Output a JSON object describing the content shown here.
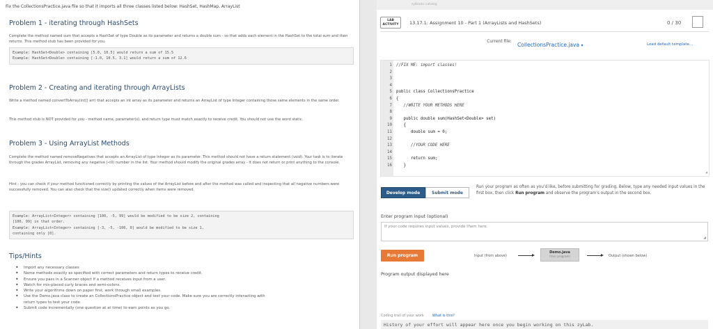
{
  "instructions": {
    "intro": "Fix the CollectionsPractice.java file so that it imports all three classes listed below: HashSet, HashMap, ArrayList",
    "p1_title": "Problem 1 - iterating through HashSets",
    "p1_text": "Complete the method named sum that accepts a HashSet of type Double as its parameter and returns a double sum - so that adds each element in the HashSet to the total sum and then returns. This method stub has been provided for you.",
    "p1_example1": "Example: HashSet<Double> containing [5.0, 10.5] would return a sum of 15.5",
    "p1_example2": "Example: HashSet<Double> containing [-1.0, 10.5, 3.1] would return a sum of 12.6",
    "p2_title": "Problem 2 - Creating and iterating through ArrayLists",
    "p2_text1": "Write a method named convertToArray(int[] arr) that accepts an int array as its parameter and returns an ArrayList of type Integer containing those same elements in the same order.",
    "p2_text2": "This method stub is NOT provided for you - method name, parameter(s), and return type must match exactly to receive credit. You should not use the word static.",
    "p3_title": "Problem 3 - Using ArrayList Methods",
    "p3_text1": "Complete the method named removeNegatives that accepts an ArrayList of type Integer as its parameter. This method should not have a return statement (void). Your task is to iterate through the grades ArrayList, removing any negative (<0) number in the list. Your method should modify the original grades array - it does not return or print anything to the console.",
    "p3_text2": "Hint - you can check if your method functioned correctly by printing the values of the ArrayList before and after the method was called and inspecting that all negative numbers were successfully removed. You can also check that the size() updated correctly when items were removed.",
    "p3_example1": "Example: ArrayList<Integer> containing [100, -5, 99] would be modified to be size 2, containing\n[100, 99] in that order.",
    "p3_example2": "Example: ArrayList<Integer> containing [-3, -5, -100, 0] would be modified to be size 1,\ncontaining only [0].",
    "tips_title": "Tips/Hints",
    "tips": [
      "Import any necessary classes",
      "Name methods exactly as specified with correct parameters and return types to receive credit.",
      "Ensure you pass in a Scanner object if a method receives input from a user.",
      "Watch for mis-placed curly braces and semi-colons.",
      "Write your algorithms down on paper first, work through small examples.",
      "Use the Demo.java class to create an CollectionsPractice object and test your code. Make sure you are correctly interacting with",
      "return types to test your code.",
      "Submit code incrementally (one question at at time) to earn points as you go."
    ]
  },
  "lab": {
    "breadcrumb": "zyBooks catalog",
    "badge_line1": "LAB",
    "badge_line2": "ACTIVITY",
    "title": "13.17.1: Assignment 10 - Part 1 (ArrayLists and HashSets)",
    "score": "0 / 30",
    "current_file_label": "Current file:",
    "current_file": "CollectionsPractice.java",
    "load_template": "Load default template...",
    "code_lines": [
      {
        "n": "1",
        "t": "//FIX ME: import classes!"
      },
      {
        "n": "2",
        "t": ""
      },
      {
        "n": "3",
        "t": ""
      },
      {
        "n": "4",
        "t": ""
      },
      {
        "n": "5",
        "t": "public class CollectionsPractice"
      },
      {
        "n": "6",
        "t": "{"
      },
      {
        "n": "7",
        "t": "   //WRITE YOUR METHODS HERE"
      },
      {
        "n": "8",
        "t": ""
      },
      {
        "n": "9",
        "t": "   public double sum(HashSet<Double> set)"
      },
      {
        "n": "10",
        "t": "   {"
      },
      {
        "n": "11",
        "t": "      double sum = 0;"
      },
      {
        "n": "12",
        "t": ""
      },
      {
        "n": "13",
        "t": "      //YOUR CODE HERE"
      },
      {
        "n": "14",
        "t": ""
      },
      {
        "n": "15",
        "t": "      return sum;"
      },
      {
        "n": "16",
        "t": "   }"
      }
    ],
    "develop_mode": "Develop mode",
    "submit_mode": "Submit mode",
    "run_desc_1": "Run your program as often as you'd like, before submitting for grading. Below, type any needed input values in the first box, then click ",
    "run_desc_bold": "Run program",
    "run_desc_2": " and observe the program's output in the second box.",
    "input_label": "Enter program input (optional)",
    "input_placeholder": "If your code requires input values, provide them here.",
    "run_program": "Run program",
    "flow_input": "Input (from above)",
    "flow_demo": "Demo.java",
    "flow_demo_sub": "(Your program)",
    "flow_output": "Output (shown below)",
    "output_label": "Program output displayed here",
    "coding_trail": "Coding trail of your work",
    "whats_this": "What is this?",
    "history": "History of your effort will appear here once you begin working on this zyLab."
  }
}
